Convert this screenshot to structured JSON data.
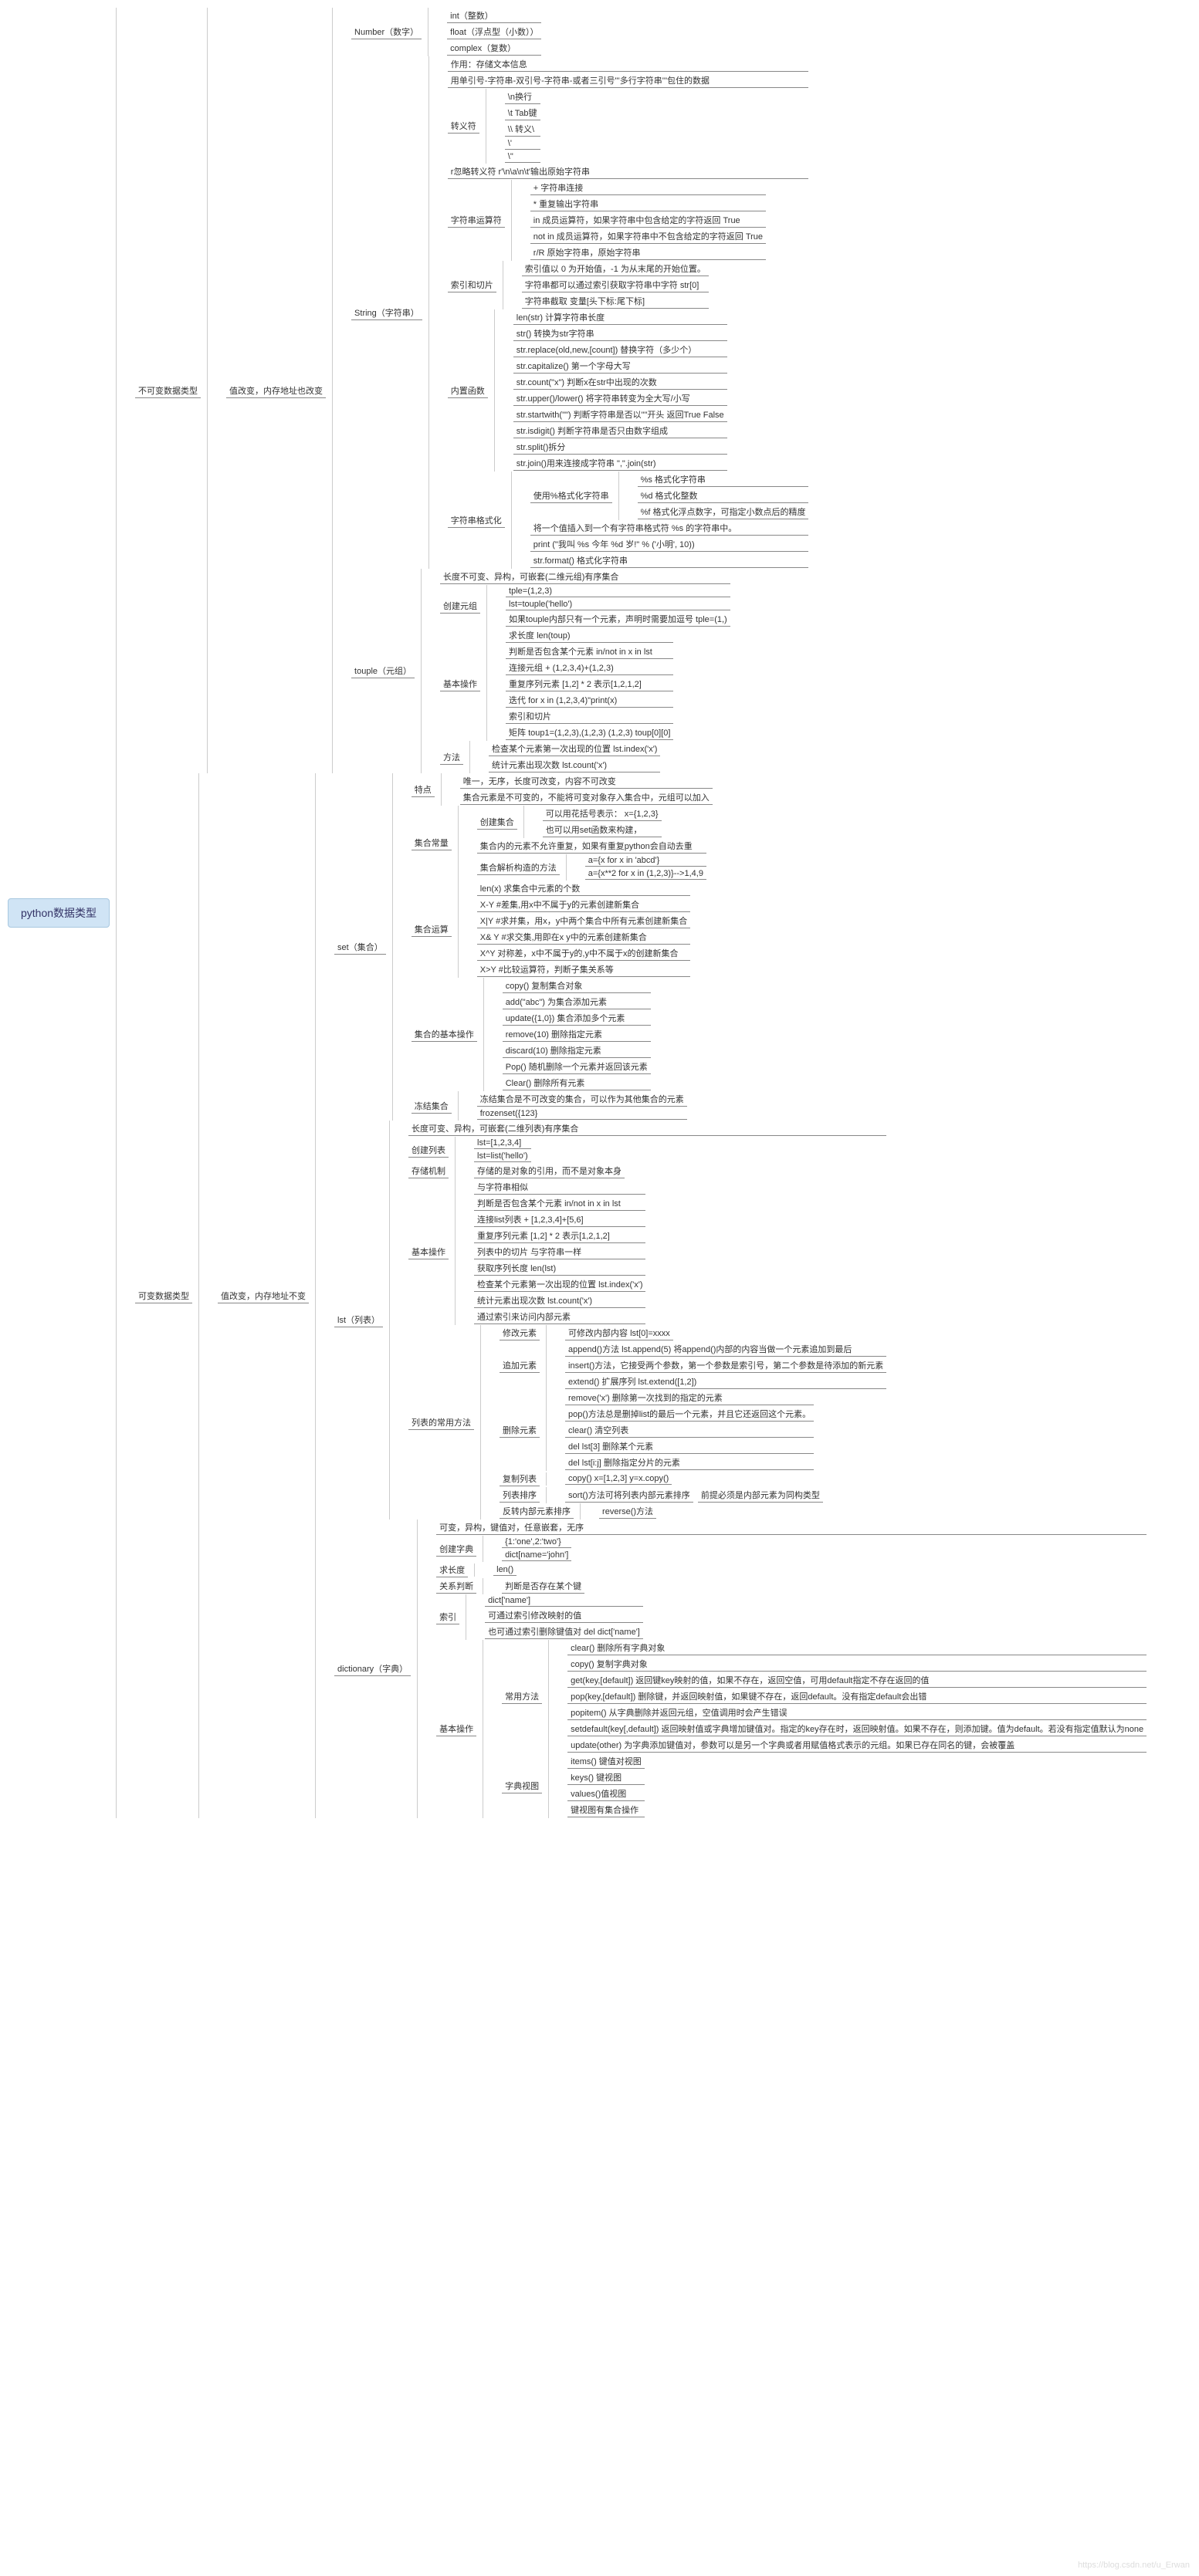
{
  "root": "python数据类型",
  "b1": {
    "title": "不可变数据类型",
    "note": "值改变，内存地址也改变",
    "number": {
      "t": "Number（数字）",
      "c": [
        "int（整数）",
        "float（浮点型（小数））",
        "complex（复数）"
      ]
    },
    "string": {
      "t": "String（字符串）",
      "n1": "作用：存储文本信息",
      "n2": "用单引号-字符串-双引号-字符串-或者三引号'''多行字符串'''包住的数据",
      "esc": {
        "t": "转义符",
        "c": [
          "\\n换行",
          "\\t Tab键",
          "\\\\ 转义\\",
          "\\'",
          "\\\""
        ]
      },
      "raw": "r忽略转义符 r'\\n\\a\\n\\t'输出原始字符串",
      "op": {
        "t": "字符串运算符",
        "c": [
          "+    字符串连接",
          "*    重复输出字符串",
          "in    成员运算符，如果字符串中包含给定的字符返回 True",
          "not in    成员运算符，如果字符串中不包含给定的字符返回 True",
          "r/R    原始字符串，原始字符串"
        ]
      },
      "slice": {
        "t": "索引和切片",
        "c": [
          "索引值以 0 为开始值，-1 为从末尾的开始位置。",
          "字符串都可以通过索引获取字符串中字符    str[0]",
          "字符串截取 变量[头下标:尾下标]"
        ]
      },
      "builtin": {
        "t": "内置函数",
        "c": [
          "len(str) 计算字符串长度",
          "str() 转换为str字符串",
          "str.replace(old,new,[count]) 替换字符（多少个）",
          "str.capitalize()  第一个字母大写",
          "str.count(\"x\") 判断x在str中出现的次数",
          "str.upper()/lower() 将字符串转变为全大写/小写",
          "str.startwith(\"\") 判断字符串是否以\"\"开头 返回True False",
          "str.isdigit() 判断字符串是否只由数字组成",
          "str.split()拆分",
          "str.join()用来连接成字符串  \",\".join(str)"
        ]
      },
      "fmt": {
        "t": "字符串格式化",
        "use": {
          "t": "使用%格式化字符串",
          "c": [
            "%s    格式化字符串",
            "%d    格式化整数",
            "%f    格式化浮点数字，可指定小数点后的精度"
          ]
        },
        "n1": "将一个值插入到一个有字符串格式符 %s 的字符串中。",
        "n2": "print (\"我叫 %s 今年 %d 岁!\" % ('小明', 10))",
        "n3": "str.format() 格式化字符串"
      }
    },
    "tuple": {
      "t": "touple（元组）",
      "n1": "长度不可变、异构，可嵌套(二维元组)有序集合",
      "create": {
        "t": "创建元组",
        "c": [
          "tple=(1,2,3)",
          "lst=touple('hello')",
          "如果touple内部只有一个元素，声明时需要加逗号 tple=(1,)"
        ]
      },
      "basic": {
        "t": "基本操作",
        "c": [
          "求长度 len(toup)",
          "判断是否包含某个元素    in/not in    x in lst",
          "连接元组 +  (1,2,3,4)+(1,2,3)",
          "重复序列元素    [1,2] * 2   表示[1,2,1,2]",
          "迭代          for x in (1,2,3,4)\"print(x)",
          "索引和切片",
          "矩阵  toup1=(1,2,3),(1,2,3) (1,2,3)  toup[0][0]"
        ]
      },
      "method": {
        "t": "方法",
        "c": [
          "检查某个元素第一次出现的位置 lst.index('x')",
          "统计元素出现次数    lst.count('x')"
        ]
      }
    }
  },
  "b2": {
    "title": "可变数据类型",
    "note": "值改变，内存地址不变",
    "set": {
      "t": "set（集合）",
      "feature": {
        "t": "特点",
        "c": [
          "唯一，无序，长度可改变，内容不可改变",
          "集合元素是不可变的，不能将可变对象存入集合中，元组可以加入"
        ]
      },
      "const": {
        "t": "集合常量",
        "create": {
          "t": "创建集合",
          "c": [
            "可以用花括号表示： x={1,2,3}",
            "也可以用set函数来构建，"
          ]
        },
        "n1": "集合内的元素不允许重复，如果有重复python会自动去重",
        "parse": {
          "t": "集合解析构造的方法",
          "c": [
            "a={x for x in 'abcd'}",
            "a={x**2 for x in (1,2,3)}-->1,4,9"
          ]
        }
      },
      "calc": {
        "t": "集合运算",
        "c": [
          "len(x)   求集合中元素的个数",
          "X-Y  #差集,用x中不属于y的元素创建新集合",
          "X|Y  #求并集，用x，y中两个集合中所有元素创建新集合",
          "X& Y #求交集,用即在x y中的元素创建新集合",
          "X^Y  对称差，x中不属于y的,y中不属于x的创建新集合",
          "X>Y #比较运算符，判断子集关系等"
        ]
      },
      "basic": {
        "t": "集合的基本操作",
        "c": [
          "copy()  复制集合对象",
          "add(\"abc\")  为集合添加元素",
          "update({1,0})  集合添加多个元素",
          "remove(10)  删除指定元素",
          "discard(10)  删除指定元素",
          "Pop()   随机删除一个元素并返回该元素",
          "Clear()   删除所有元素"
        ]
      },
      "frozen": {
        "t": "冻结集合",
        "c": [
          "冻结集合是不可改变的集合，可以作为其他集合的元素",
          "frozenset({123}"
        ]
      }
    },
    "list": {
      "t": "lst（列表）",
      "n1": "长度可变、异构，可嵌套(二维列表)有序集合",
      "create": {
        "t": "创建列表",
        "c": [
          "lst=[1,2,3,4]",
          "lst=list('hello')"
        ]
      },
      "store": {
        "t": "存储机制",
        "n": "存储的是对象的引用，而不是对象本身"
      },
      "basic": {
        "t": "基本操作",
        "c": [
          "与字符串相似",
          "判断是否包含某个元素    in/not in    x in lst",
          "连接list列表 +  [1,2,3,4]+[5,6]",
          "重复序列元素    [1,2] * 2   表示[1,2,1,2]",
          "列表中的切片 与字符串一样",
          "获取序列长度    len(lst)",
          "检查某个元素第一次出现的位置 lst.index('x')",
          "统计元素出现次数    lst.count('x')",
          "通过索引来访问内部元素"
        ]
      },
      "methods": {
        "t": "列表的常用方法",
        "mod": {
          "t": "修改元素",
          "n": "可修改内部内容  lst[0]=xxxx"
        },
        "add": {
          "t": "追加元素",
          "c": [
            "append()方法  lst.append(5)  将append()内部的内容当做一个元素追加到最后",
            "insert()方法，它接受两个参数，第一个参数是索引号，第二个参数是待添加的新元素",
            "extend()  扩展序列    lst.extend([1,2])"
          ]
        },
        "del": {
          "t": "删除元素",
          "c": [
            "remove('x')    删除第一次找到的指定的元素",
            "pop()方法总是删掉list的最后一个元素，并且它还返回这个元素。",
            "clear()    清空列表",
            "del lst[3]    删除某个元素",
            "del lst[i:j]    删除指定分片的元素"
          ]
        },
        "copy": {
          "t": "复制列表",
          "n": "copy()  x=[1,2,3] y=x.copy()"
        },
        "sort": {
          "t": "列表排序",
          "n": "sort()方法可将列表内部元素排序",
          "e": "前提必须是内部元素为同构类型"
        },
        "rev": {
          "t": "反转内部元素排序",
          "n": "reverse()方法"
        }
      }
    },
    "dict": {
      "t": "dictionary（字典）",
      "n1": "可变，异构，键值对，任意嵌套，无序",
      "create": {
        "t": "创建字典",
        "c": [
          "{1:'one',2:'two'}",
          "dict[name='john']"
        ]
      },
      "len": {
        "t": "求长度",
        "n": "len()"
      },
      "rel": {
        "t": "关系判断",
        "n": "判断是否存在某个键"
      },
      "idx": {
        "t": "索引",
        "c": [
          "dict['name']",
          "可通过索引修改映射的值",
          "也可通过索引删除键值对  del dict['name']"
        ]
      },
      "basic": {
        "t": "基本操作",
        "methods": {
          "t": "常用方法",
          "c": [
            "clear()  删除所有字典对象",
            "copy()  复制字典对象",
            "get(key,[default])  返回键key映射的值，如果不存在，返回空值，可用default指定不存在返回的值",
            "pop(key,[default])   删除键，并返回映射值，如果键不存在，返回default。没有指定default会出错",
            "popitem()   从字典删除并返回元组，空值调用时会产生错误",
            "setdefault(key[,default])  返回映射值或字典增加键值对。指定的key存在时，返回映射值。如果不存在，则添加键。值为default。若没有指定值默认为none",
            "update(other)  为字典添加键值对，参数可以是另一个字典或者用赋值格式表示的元组。如果已存在同名的键，会被覆盖"
          ]
        },
        "view": {
          "t": "字典视图",
          "c": [
            "items()  键值对视图",
            "keys()  键视图",
            "values()值视图",
            "键视图有集合操作"
          ]
        }
      }
    }
  }
}
